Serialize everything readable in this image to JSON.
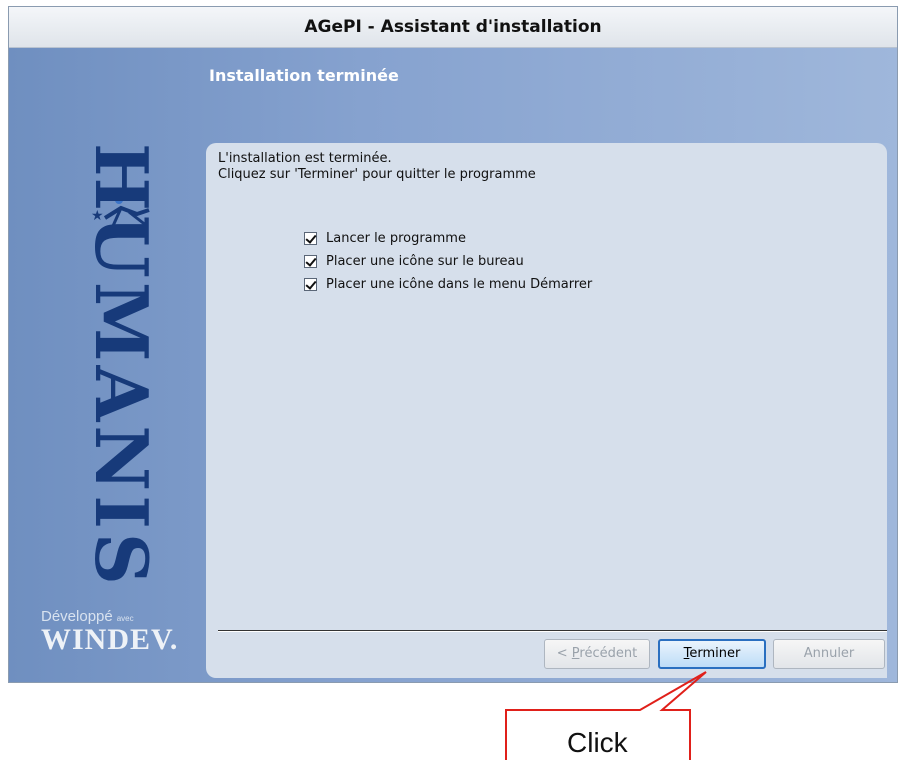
{
  "window": {
    "title": "AGePI - Assistant d'installation",
    "header_title": "Installation terminée"
  },
  "brand": {
    "logo_text": "HUMANIS",
    "developed_label": "Développé",
    "developed_avec": "avec",
    "windev": "WINDEV."
  },
  "content": {
    "line1": "L'installation est terminée.",
    "line2": "Cliquez sur 'Terminer' pour quitter le programme",
    "options": [
      {
        "label": "Lancer le programme",
        "checked": true
      },
      {
        "label": "Placer une icône sur le bureau",
        "checked": true
      },
      {
        "label": "Placer une icône dans le menu Démarrer",
        "checked": true
      }
    ]
  },
  "buttons": {
    "prev_prefix": "< ",
    "prev_mnemonic": "P",
    "prev_rest": "récédent",
    "finish_mnemonic": "T",
    "finish_rest": "erminer",
    "cancel": "Annuler"
  },
  "annotation": {
    "text": "Click",
    "color": "#e0201a"
  }
}
